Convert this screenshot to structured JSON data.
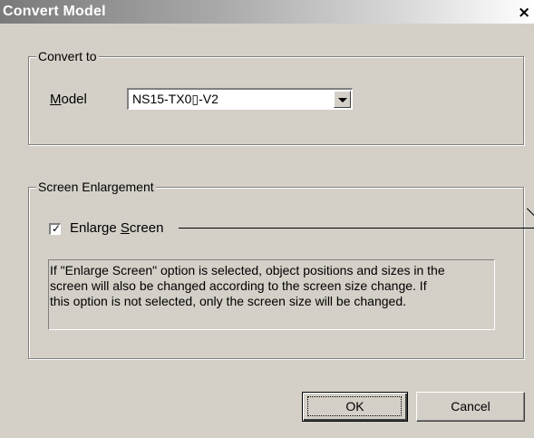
{
  "window": {
    "title": "Convert Model",
    "close_glyph": "×"
  },
  "convert_to": {
    "legend": "Convert to",
    "model_label_accel": "M",
    "model_label_rest": "odel",
    "model_value": "NS15-TX0▯-V2"
  },
  "screen_enlargement": {
    "legend": "Screen Enlargement",
    "checkbox_label_pre": "Enlarge ",
    "checkbox_label_accel": "S",
    "checkbox_label_post": "creen",
    "checked": true,
    "description_lines": [
      "If \"Enlarge Screen\" option is selected, object positions and sizes in the",
      "screen will also be changed according to the screen size change. If",
      "this option is not selected, only the screen size will be changed."
    ]
  },
  "buttons": {
    "ok_label": "OK",
    "cancel_label": "Cancel"
  },
  "icons": {
    "close": "close-icon",
    "dropdown": "chevron-down-icon",
    "check": "check-icon"
  }
}
